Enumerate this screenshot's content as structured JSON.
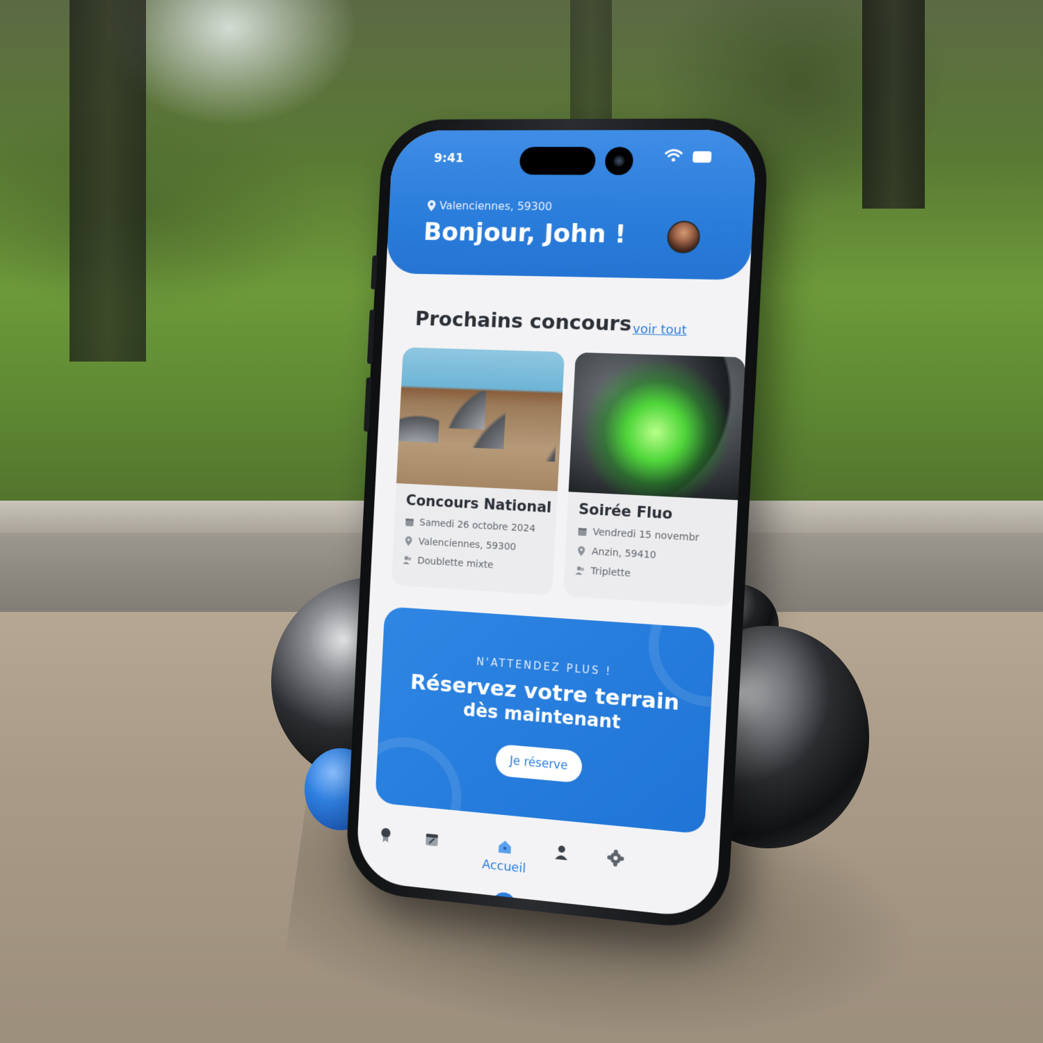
{
  "status_bar": {
    "time": "9:41"
  },
  "header": {
    "location": "Valenciennes, 59300",
    "greeting": "Bonjour, John !"
  },
  "section": {
    "title": "Prochains concours",
    "see_all": "voir tout"
  },
  "competitions": [
    {
      "title": "Concours National",
      "date": "Samedi 26 octobre 2024",
      "location": "Valenciennes, 59300",
      "format": "Doublette mixte"
    },
    {
      "title": "Soirée Fluo",
      "date": "Vendredi 15 novembr",
      "location": "Anzin, 59410",
      "format": "Triplette"
    }
  ],
  "promo": {
    "eyebrow": "N'ATTENDEZ PLUS !",
    "title": "Réservez votre terrain",
    "subtitle": "dès maintenant",
    "button": "Je réserve"
  },
  "tab_bar": {
    "items": [
      {
        "icon": "award-icon"
      },
      {
        "icon": "calendar-icon"
      },
      {
        "icon": "home-icon",
        "label": "Accueil",
        "active": true
      },
      {
        "icon": "user-icon"
      },
      {
        "icon": "settings-icon"
      }
    ]
  },
  "colors": {
    "primary": "#2a7ddb",
    "text_dark": "#2b2f36",
    "text_muted": "#5f646c",
    "screen_bg": "#f3f3f5"
  }
}
